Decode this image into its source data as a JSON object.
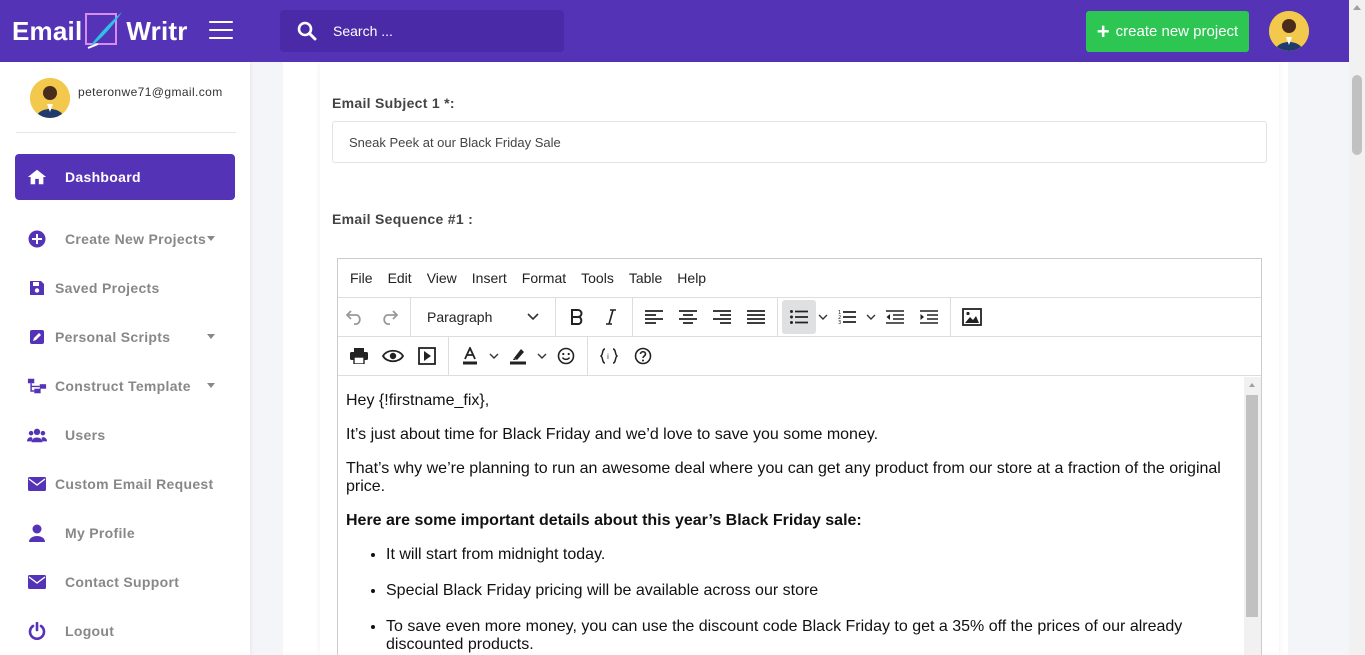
{
  "app": {
    "logo_left": "Email",
    "logo_right": "Writr"
  },
  "header": {
    "search_placeholder": "Search ...",
    "new_project_label": "create new project"
  },
  "sidebar": {
    "user_email": "peteronwe71@gmail.com",
    "items": [
      {
        "label": "Dashboard",
        "icon": "home-icon"
      },
      {
        "label": "Create New Projects",
        "icon": "plus-circle-icon"
      },
      {
        "label": "Saved Projects",
        "icon": "save-icon"
      },
      {
        "label": "Personal Scripts",
        "icon": "edit-icon"
      },
      {
        "label": "Construct Template",
        "icon": "sitemap-icon"
      },
      {
        "label": "Users",
        "icon": "users-icon"
      },
      {
        "label": "Custom Email Request",
        "icon": "envelope-icon"
      },
      {
        "label": "My Profile",
        "icon": "user-icon"
      },
      {
        "label": "Contact Support",
        "icon": "envelope-icon"
      },
      {
        "label": "Logout",
        "icon": "power-icon"
      }
    ]
  },
  "form": {
    "subject_label": "Email Subject 1 *:",
    "subject_value": "Sneak Peek at our Black Friday Sale",
    "sequence_label": "Email Sequence #1 :"
  },
  "editor": {
    "menu": [
      "File",
      "Edit",
      "View",
      "Insert",
      "Format",
      "Tools",
      "Table",
      "Help"
    ],
    "block_format": "Paragraph",
    "content": {
      "greeting": "Hey {!firstname_fix},",
      "p1": "It’s just about time for Black Friday and we’d love to save you some money.",
      "p2": "That’s why we’re planning to run an awesome deal where you can get any product from our store at a fraction of the original price.",
      "heading": "Here are some important details about this year’s Black Friday sale:",
      "bullets": [
        "It will start from midnight today.",
        "Special Black Friday pricing will be available across our store",
        "To save even more money, you can use the discount code Black Friday to get a 35% off the prices of our already discounted products."
      ]
    }
  },
  "colors": {
    "brand": "#5533b6",
    "cta": "#2dc653"
  }
}
